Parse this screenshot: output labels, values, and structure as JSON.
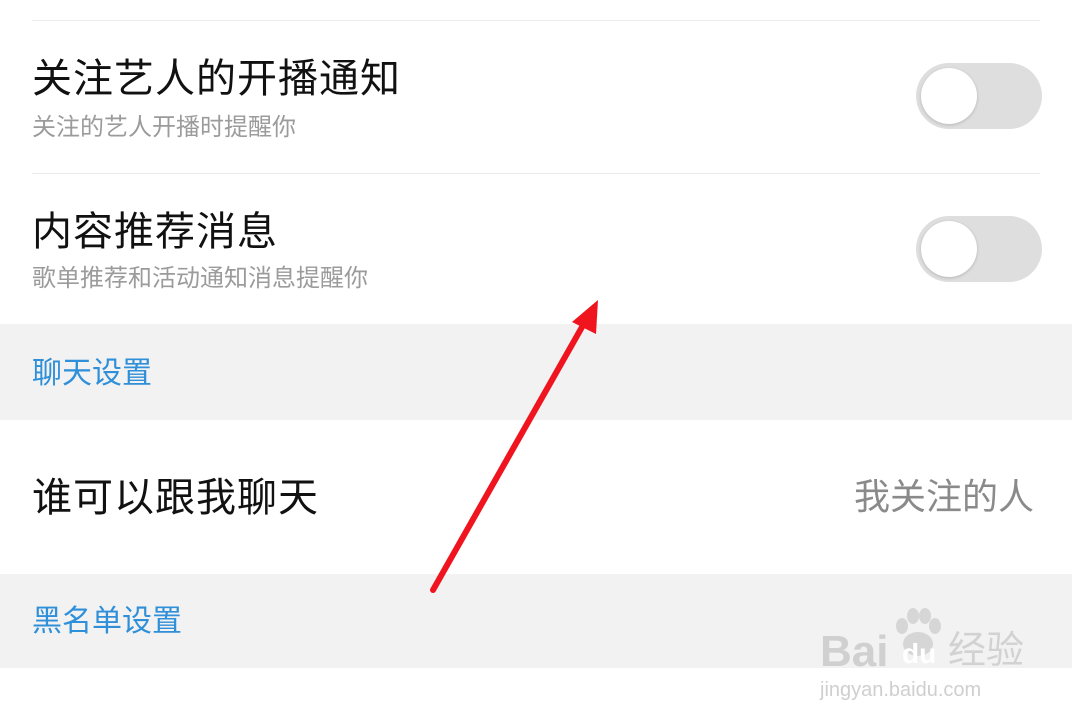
{
  "settings": {
    "follow_artist": {
      "title": "关注艺人的开播通知",
      "subtitle": "关注的艺人开播时提醒你",
      "enabled": false
    },
    "recommend": {
      "title": "内容推荐消息",
      "subtitle": "歌单推荐和活动通知消息提醒你",
      "enabled": false
    }
  },
  "chat_section": {
    "header": "聊天设置",
    "who_can_chat": {
      "label": "谁可以跟我聊天",
      "value": "我关注的人"
    }
  },
  "blacklist_section": {
    "header": "黑名单设置"
  },
  "watermark": {
    "brand": "Bai",
    "brand_suffix": "du",
    "product": "经验",
    "url": "jingyan.baidu.com"
  },
  "colors": {
    "accent": "#2f8fd8",
    "annotation_arrow": "#f0141e",
    "section_bg": "#f2f2f2",
    "toggle_off": "#dedede"
  }
}
